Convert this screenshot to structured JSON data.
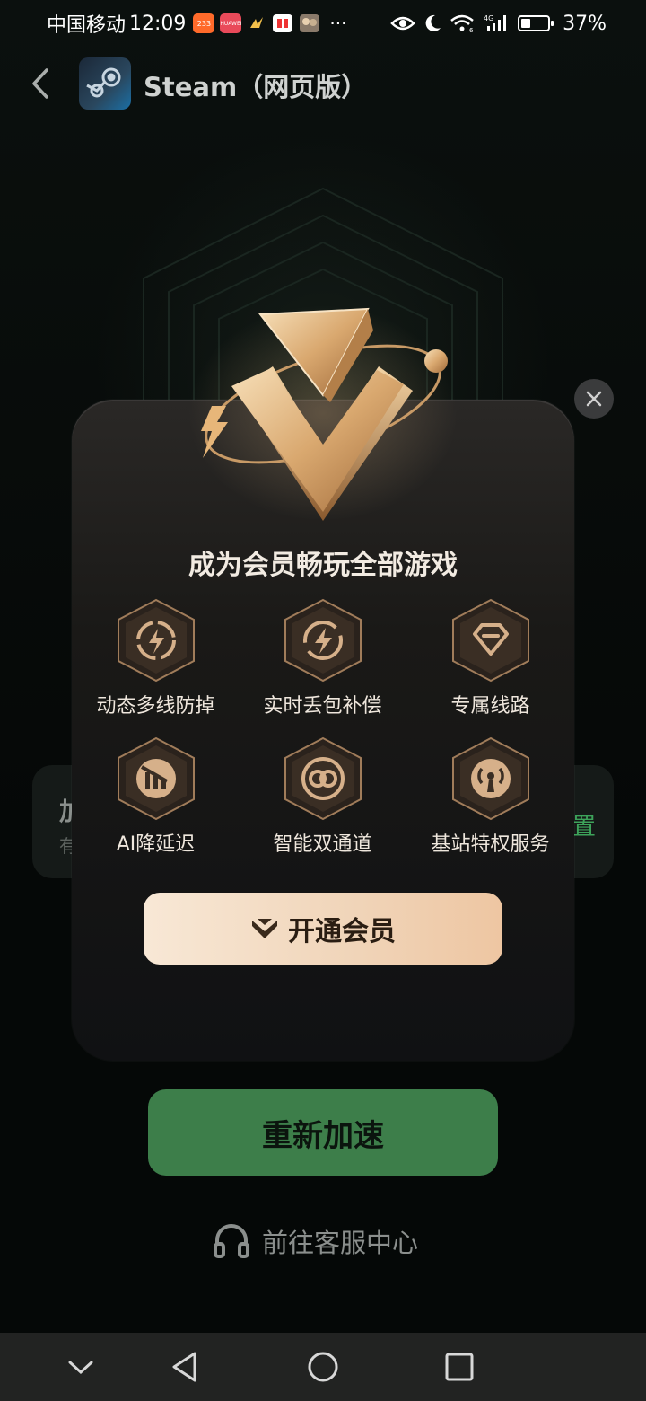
{
  "status_bar": {
    "carrier": "中国移动",
    "time": "12:09",
    "app_badges": [
      "233",
      "HUAWEI"
    ],
    "battery_percent": "37%",
    "battery_level": 0.37,
    "network": "4G",
    "overflow": "···"
  },
  "header": {
    "back_icon": "chevron-left-icon",
    "app_icon": "steam-logo",
    "title": "Steam（网页版）"
  },
  "background_card": {
    "title_partial": "加",
    "subtitle_partial": "有",
    "right_partial": "置"
  },
  "modal": {
    "title": "成为会员畅玩全部游戏",
    "features": [
      {
        "label": "动态多线防掉",
        "icon": "multi-line-icon"
      },
      {
        "label": "实时丢包补偿",
        "icon": "bolt-refresh-icon"
      },
      {
        "label": "专属线路",
        "icon": "diamond-icon"
      },
      {
        "label": "AI降延迟",
        "icon": "latency-down-icon"
      },
      {
        "label": "智能双通道",
        "icon": "dual-channel-icon"
      },
      {
        "label": "基站特权服务",
        "icon": "signal-tower-icon"
      }
    ],
    "cta_label": "开通会员",
    "accent": "#e9c79f"
  },
  "actions": {
    "restart_label": "重新加速",
    "support_label": "前往客服中心"
  },
  "colors": {
    "green_button": "#3d7e4a",
    "gold": "#e9c79f"
  }
}
